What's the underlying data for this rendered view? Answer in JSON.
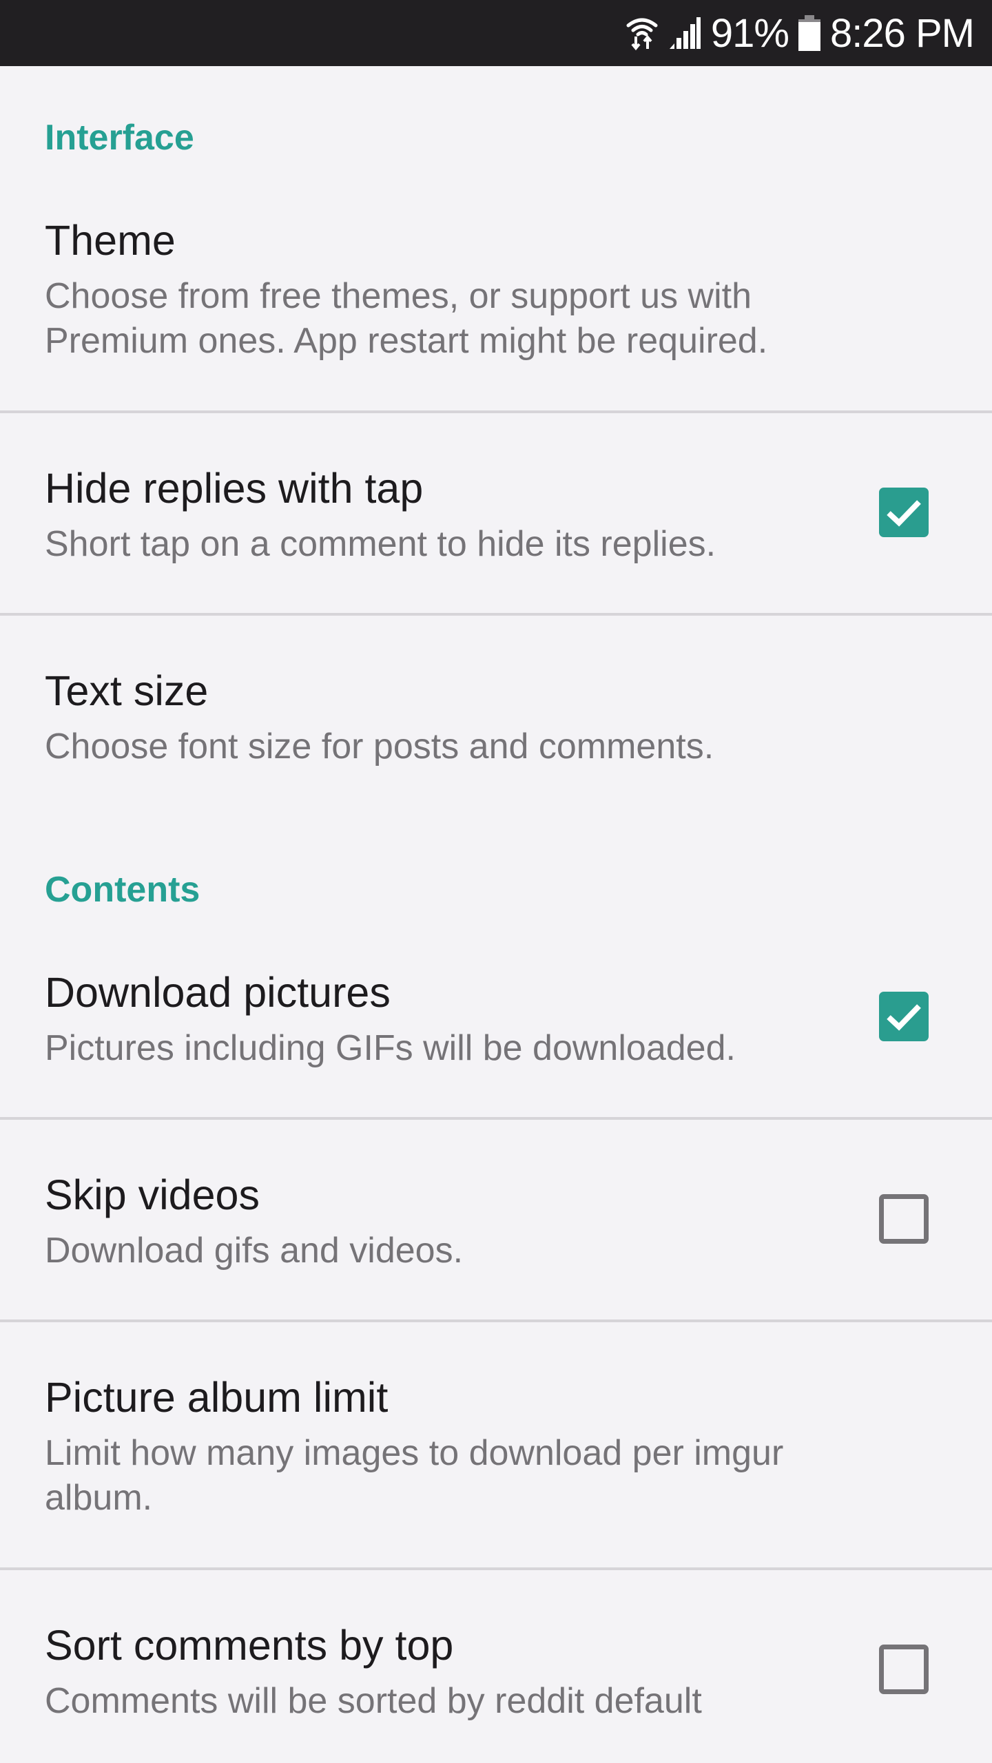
{
  "status_bar": {
    "wifi_icon": "wifi-data-activity-icon",
    "signal_icon": "cellular-signal-icon",
    "battery_percent": "91%",
    "battery_icon": "battery-icon",
    "time": "8:26 PM"
  },
  "colors": {
    "accent": "#2a9d8f",
    "title_text": "#1d1b1e",
    "summary_text": "#757377",
    "background": "#f4f3f6",
    "status_bar_bg": "#211f22",
    "divider": "#d6d4d8"
  },
  "sections": [
    {
      "header": "Interface",
      "items": [
        {
          "title": "Theme",
          "summary": "Choose from free themes, or support us with Premium ones. App restart might be required.",
          "checkbox": null
        },
        {
          "title": "Hide replies with tap",
          "summary": "Short tap on a comment to hide its replies.",
          "checkbox": true
        },
        {
          "title": "Text size",
          "summary": "Choose font size for posts and comments.",
          "checkbox": null
        }
      ]
    },
    {
      "header": "Contents",
      "items": [
        {
          "title": "Download pictures",
          "summary": "Pictures including GIFs will be downloaded.",
          "checkbox": true
        },
        {
          "title": "Skip videos",
          "summary": "Download gifs and videos.",
          "checkbox": false
        },
        {
          "title": "Picture album limit",
          "summary": "Limit how many images to download per imgur album.",
          "checkbox": null
        },
        {
          "title": "Sort comments by top",
          "summary": "Comments will be sorted by reddit default",
          "checkbox": false
        }
      ]
    }
  ]
}
